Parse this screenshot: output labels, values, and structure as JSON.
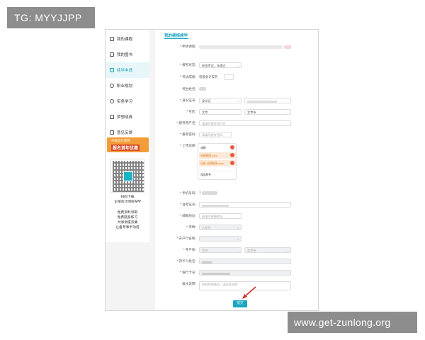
{
  "watermarks": {
    "top_left": "TG: MYYJJPP",
    "bottom_right": "www.get-zunlong.org"
  },
  "sidebar": {
    "items": [
      {
        "label": "我的课程",
        "icon": "monitor-icon",
        "active": false
      },
      {
        "label": "我的图书",
        "icon": "book-icon",
        "active": false
      },
      {
        "label": "续学申请",
        "icon": "document-icon",
        "active": true
      },
      {
        "label": "职业规划",
        "icon": "target-icon",
        "active": false
      },
      {
        "label": "实务学习",
        "icon": "clock-icon",
        "active": false
      },
      {
        "label": "梦想成真",
        "icon": "thumbs-up-icon",
        "active": false
      },
      {
        "label": "意见反馈",
        "icon": "message-icon",
        "active": false
      }
    ],
    "banner": {
      "line1": "中级会计职称",
      "line2": "报名首年优惠"
    },
    "qr_caption_1": "扫码下载",
    "qr_caption_2": "正保会计网校APP",
    "features": [
      "免费资料领取",
      "免费随身练习",
      "大咖讲座云集",
      "让备考事半功倍"
    ]
  },
  "main": {
    "title": "我的续报续学",
    "rows": [
      {
        "label": "申请课程:",
        "required": true,
        "value": ""
      },
      {
        "label": "报考状态:",
        "required": true,
        "value": "参加考试，未通过"
      },
      {
        "label": "考试成绩:",
        "required": true,
        "value": "初级会计实务"
      },
      {
        "label": "考生姓名:",
        "required": false,
        "value": ""
      },
      {
        "label": "身份证号:",
        "required": true,
        "value": "身份证"
      },
      {
        "label": "考区:",
        "required": true,
        "value": "北京",
        "value2": "北京市"
      },
      {
        "label": "报考用户名:",
        "required": true,
        "value": "请填写报考用户名"
      },
      {
        "label": "报考密码:",
        "required": true,
        "value": "请填写报考密码"
      },
      {
        "label": "上传成绩:",
        "required": true,
        "value": ""
      },
      {
        "label": "手机号码:",
        "required": true,
        "value": "1"
      },
      {
        "label": "准考证号:",
        "required": true,
        "value": ""
      },
      {
        "label": "邮箱地址:",
        "required": true,
        "value": "请填写邮箱地址"
      },
      {
        "label": "币种:",
        "required": true,
        "value": "人民币"
      },
      {
        "label": "开户行名称:",
        "required": true,
        "value": ""
      },
      {
        "label": "开户地:",
        "required": true,
        "value": "北京",
        "value2": "北京市"
      },
      {
        "label": "持卡人姓名:",
        "required": true,
        "value": ""
      },
      {
        "label": "银行卡号:",
        "required": true,
        "value": ""
      },
      {
        "label": "备注说明:",
        "required": false,
        "value": "如有特殊情况，请在此说明"
      }
    ],
    "upload": {
      "header": "成绩",
      "files": [
        "成绩截图.png",
        "初级-成绩截图.png"
      ],
      "footer": "添加附件"
    },
    "submit_label": "提交"
  },
  "colors": {
    "accent": "#19a6c1",
    "required": "#e74c3c",
    "banner": "#f29d38"
  }
}
